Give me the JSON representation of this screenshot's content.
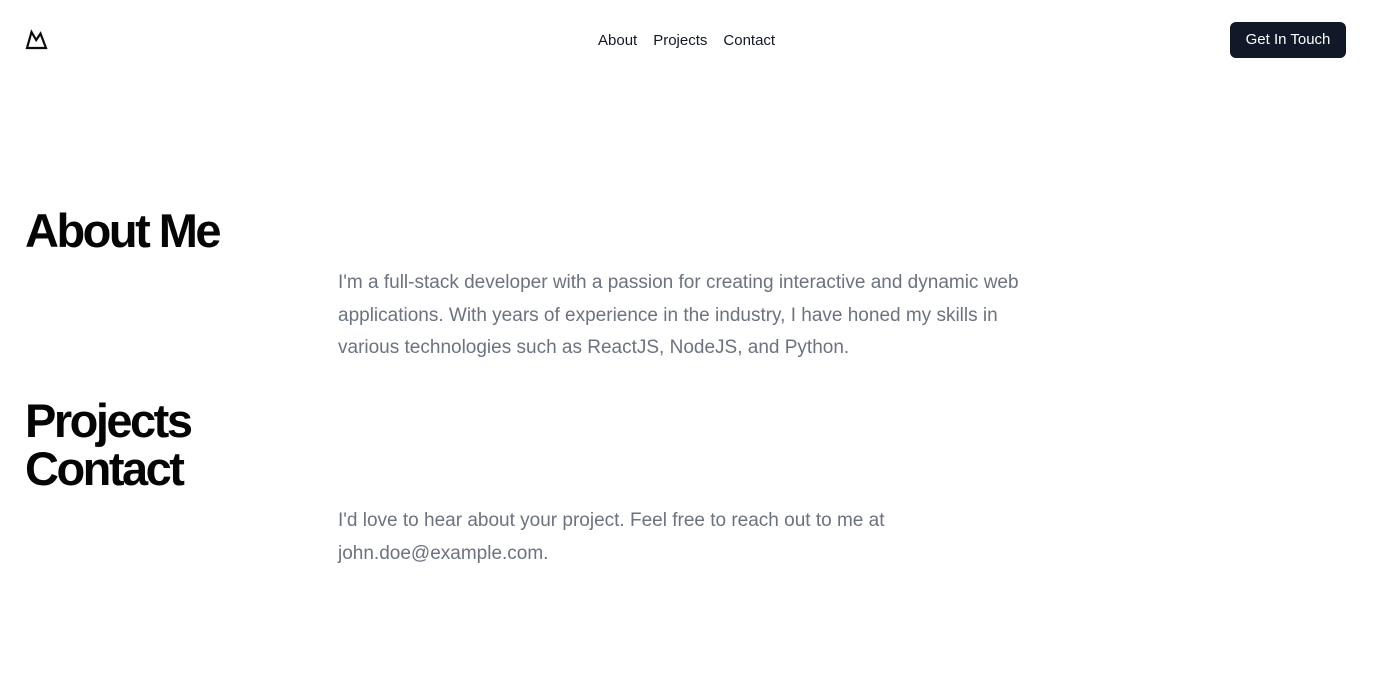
{
  "header": {
    "logo_icon": "mountain-outline-icon",
    "nav": [
      {
        "label": "About"
      },
      {
        "label": "Projects"
      },
      {
        "label": "Contact"
      }
    ],
    "cta_label": "Get In Touch"
  },
  "sections": {
    "about": {
      "title": "About Me",
      "body": "I'm a full-stack developer with a passion for creating interactive and dynamic web applications. With years of experience in the industry, I have honed my skills in various technologies such as ReactJS, NodeJS, and Python."
    },
    "projects": {
      "title": "Projects"
    },
    "contact": {
      "title": "Contact",
      "body": "I'd love to hear about your project. Feel free to reach out to me at john.doe@example.com."
    }
  },
  "colors": {
    "background": "#ffffff",
    "text": "#050505",
    "muted_text": "#6b7280",
    "button": "#111827",
    "button_text": "#ffffff"
  }
}
